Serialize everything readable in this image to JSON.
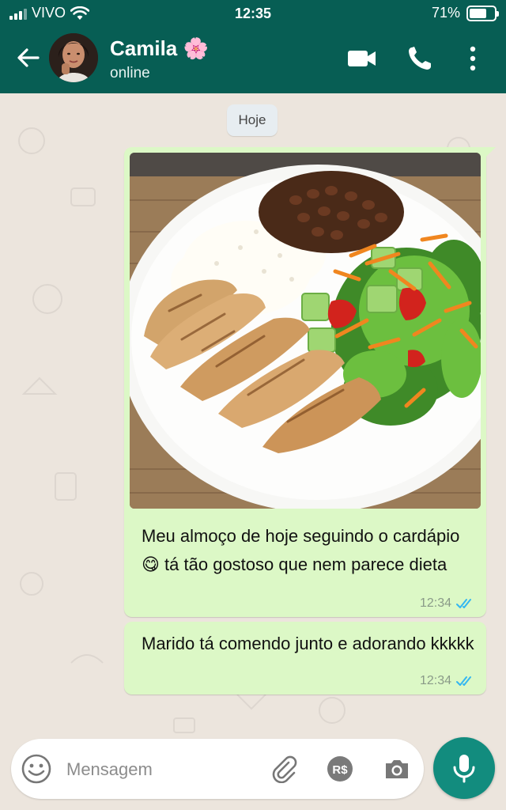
{
  "status_bar": {
    "carrier": "VIVO",
    "time": "12:35",
    "battery_text": "71%",
    "battery_level": 0.71
  },
  "header": {
    "contact_name": "Camila 🌸",
    "presence": "online",
    "icons": [
      "back-arrow-icon",
      "avatar",
      "video-call-icon",
      "phone-icon",
      "more-vert-icon"
    ]
  },
  "chat": {
    "date_chip": "Hoje",
    "messages": [
      {
        "type": "image",
        "text": "Meu almoço de hoje seguindo o cardápio 😋 tá tão gostoso que nem parece dieta",
        "time": "12:34",
        "status": "read"
      },
      {
        "type": "text",
        "text": "Marido tá comendo junto e adorando kkkkk",
        "time": "12:34",
        "status": "read"
      }
    ]
  },
  "composer": {
    "placeholder": "Mensagem",
    "icons": [
      "emoji-icon",
      "attach-icon",
      "payment-icon",
      "camera-icon",
      "mic-icon"
    ],
    "payment_label": "R$"
  },
  "colors": {
    "header": "#075e54",
    "outgoing_bubble": "#dcf8c6",
    "read_ticks": "#34b7f1",
    "mic_button": "#128c7e",
    "chat_bg": "#ece5dd"
  }
}
